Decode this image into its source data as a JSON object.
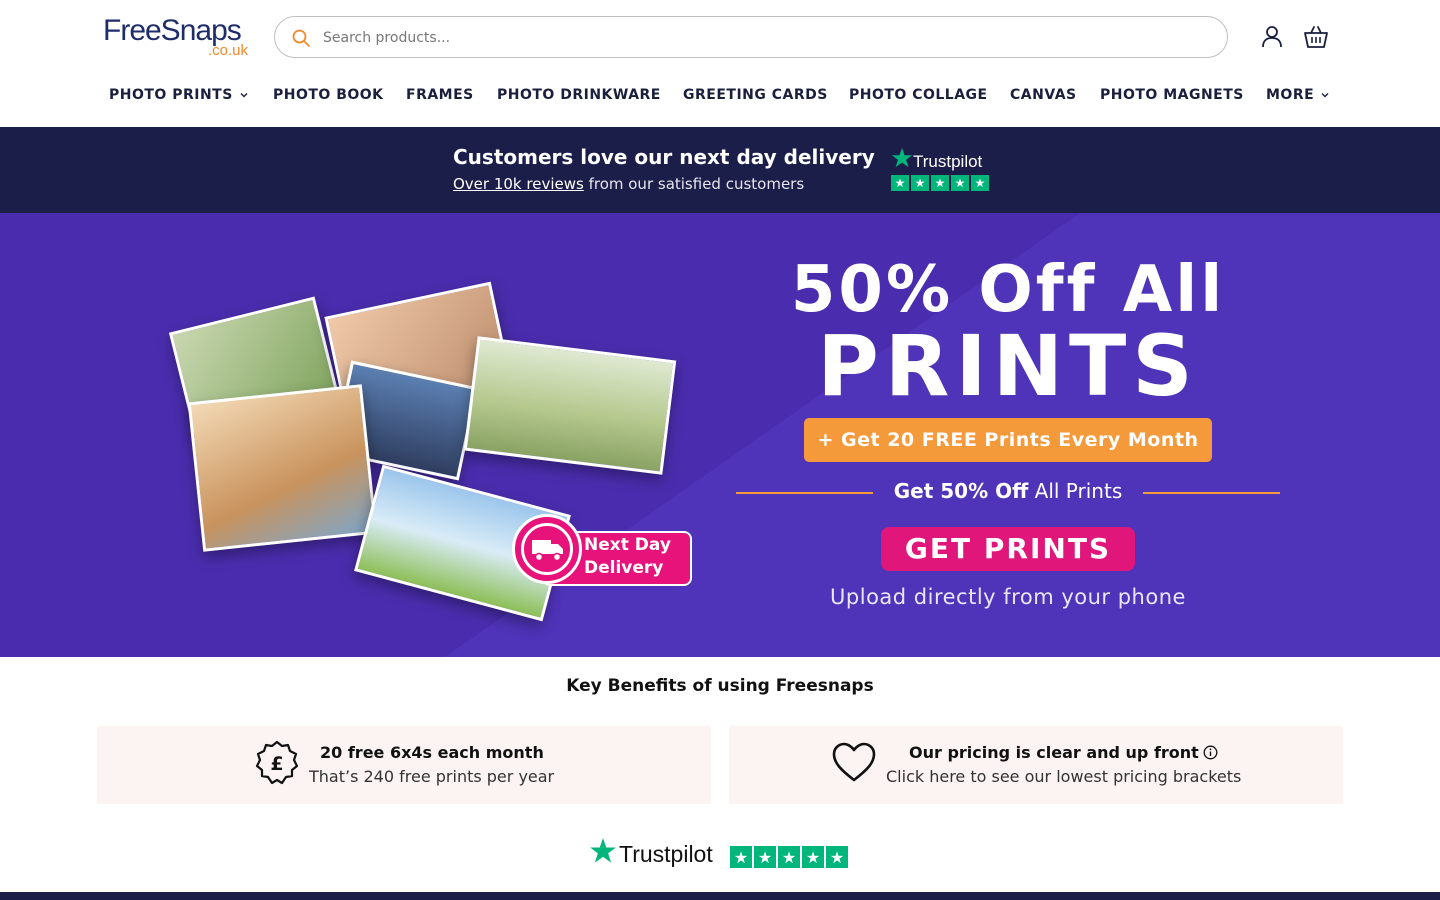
{
  "brand": {
    "logo_main": "FreeSnaps",
    "logo_sub": ".co.uk",
    "colors": {
      "navy": "#1c1e4a",
      "purple": "#4a2dae",
      "orange": "#f59a3b",
      "pink": "#e0167b",
      "trustpilot_green": "#00b67a"
    }
  },
  "search": {
    "placeholder": "Search products..."
  },
  "header_icons": [
    "user-icon",
    "basket-icon"
  ],
  "nav": {
    "items": [
      {
        "label": "PHOTO PRINTS",
        "has_dropdown": true
      },
      {
        "label": "PHOTO BOOK",
        "has_dropdown": false
      },
      {
        "label": "FRAMES",
        "has_dropdown": false
      },
      {
        "label": "PHOTO DRINKWARE",
        "has_dropdown": false
      },
      {
        "label": "GREETING CARDS",
        "has_dropdown": false
      },
      {
        "label": "PHOTO COLLAGE",
        "has_dropdown": false
      },
      {
        "label": "CANVAS",
        "has_dropdown": false
      },
      {
        "label": "PHOTO MAGNETS",
        "has_dropdown": false
      },
      {
        "label": "MORE",
        "has_dropdown": true
      }
    ]
  },
  "trust_strip": {
    "title": "Customers love our next day delivery",
    "reviews_link": "Over 10k reviews",
    "reviews_rest": " from our satisfied customers",
    "trustpilot_word": "Trustpilot",
    "rating_stars": 5
  },
  "hero": {
    "title_line1": "50% Off All",
    "title_line2": "PRINTS",
    "promo": "+ Get 20 FREE Prints Every Month",
    "divider_bold": "Get 50% Off",
    "divider_rest": " All Prints",
    "cta": "GET PRINTS",
    "upload_note": "Upload directly from your phone",
    "delivery_badge": {
      "line1": "Next Day",
      "line2": "Delivery"
    }
  },
  "benefits": {
    "title": "Key Benefits of using Freesnaps",
    "cards": [
      {
        "icon": "pound-badge-icon",
        "title": "20 free 6x4s each month",
        "subtitle": "That’s 240 free prints per year"
      },
      {
        "icon": "heart-icon",
        "title": "Our pricing is clear and up front",
        "subtitle": "Click here to see our lowest pricing brackets"
      }
    ]
  },
  "trustpilot_footer": {
    "word": "Trustpilot",
    "rating_stars": 5
  }
}
